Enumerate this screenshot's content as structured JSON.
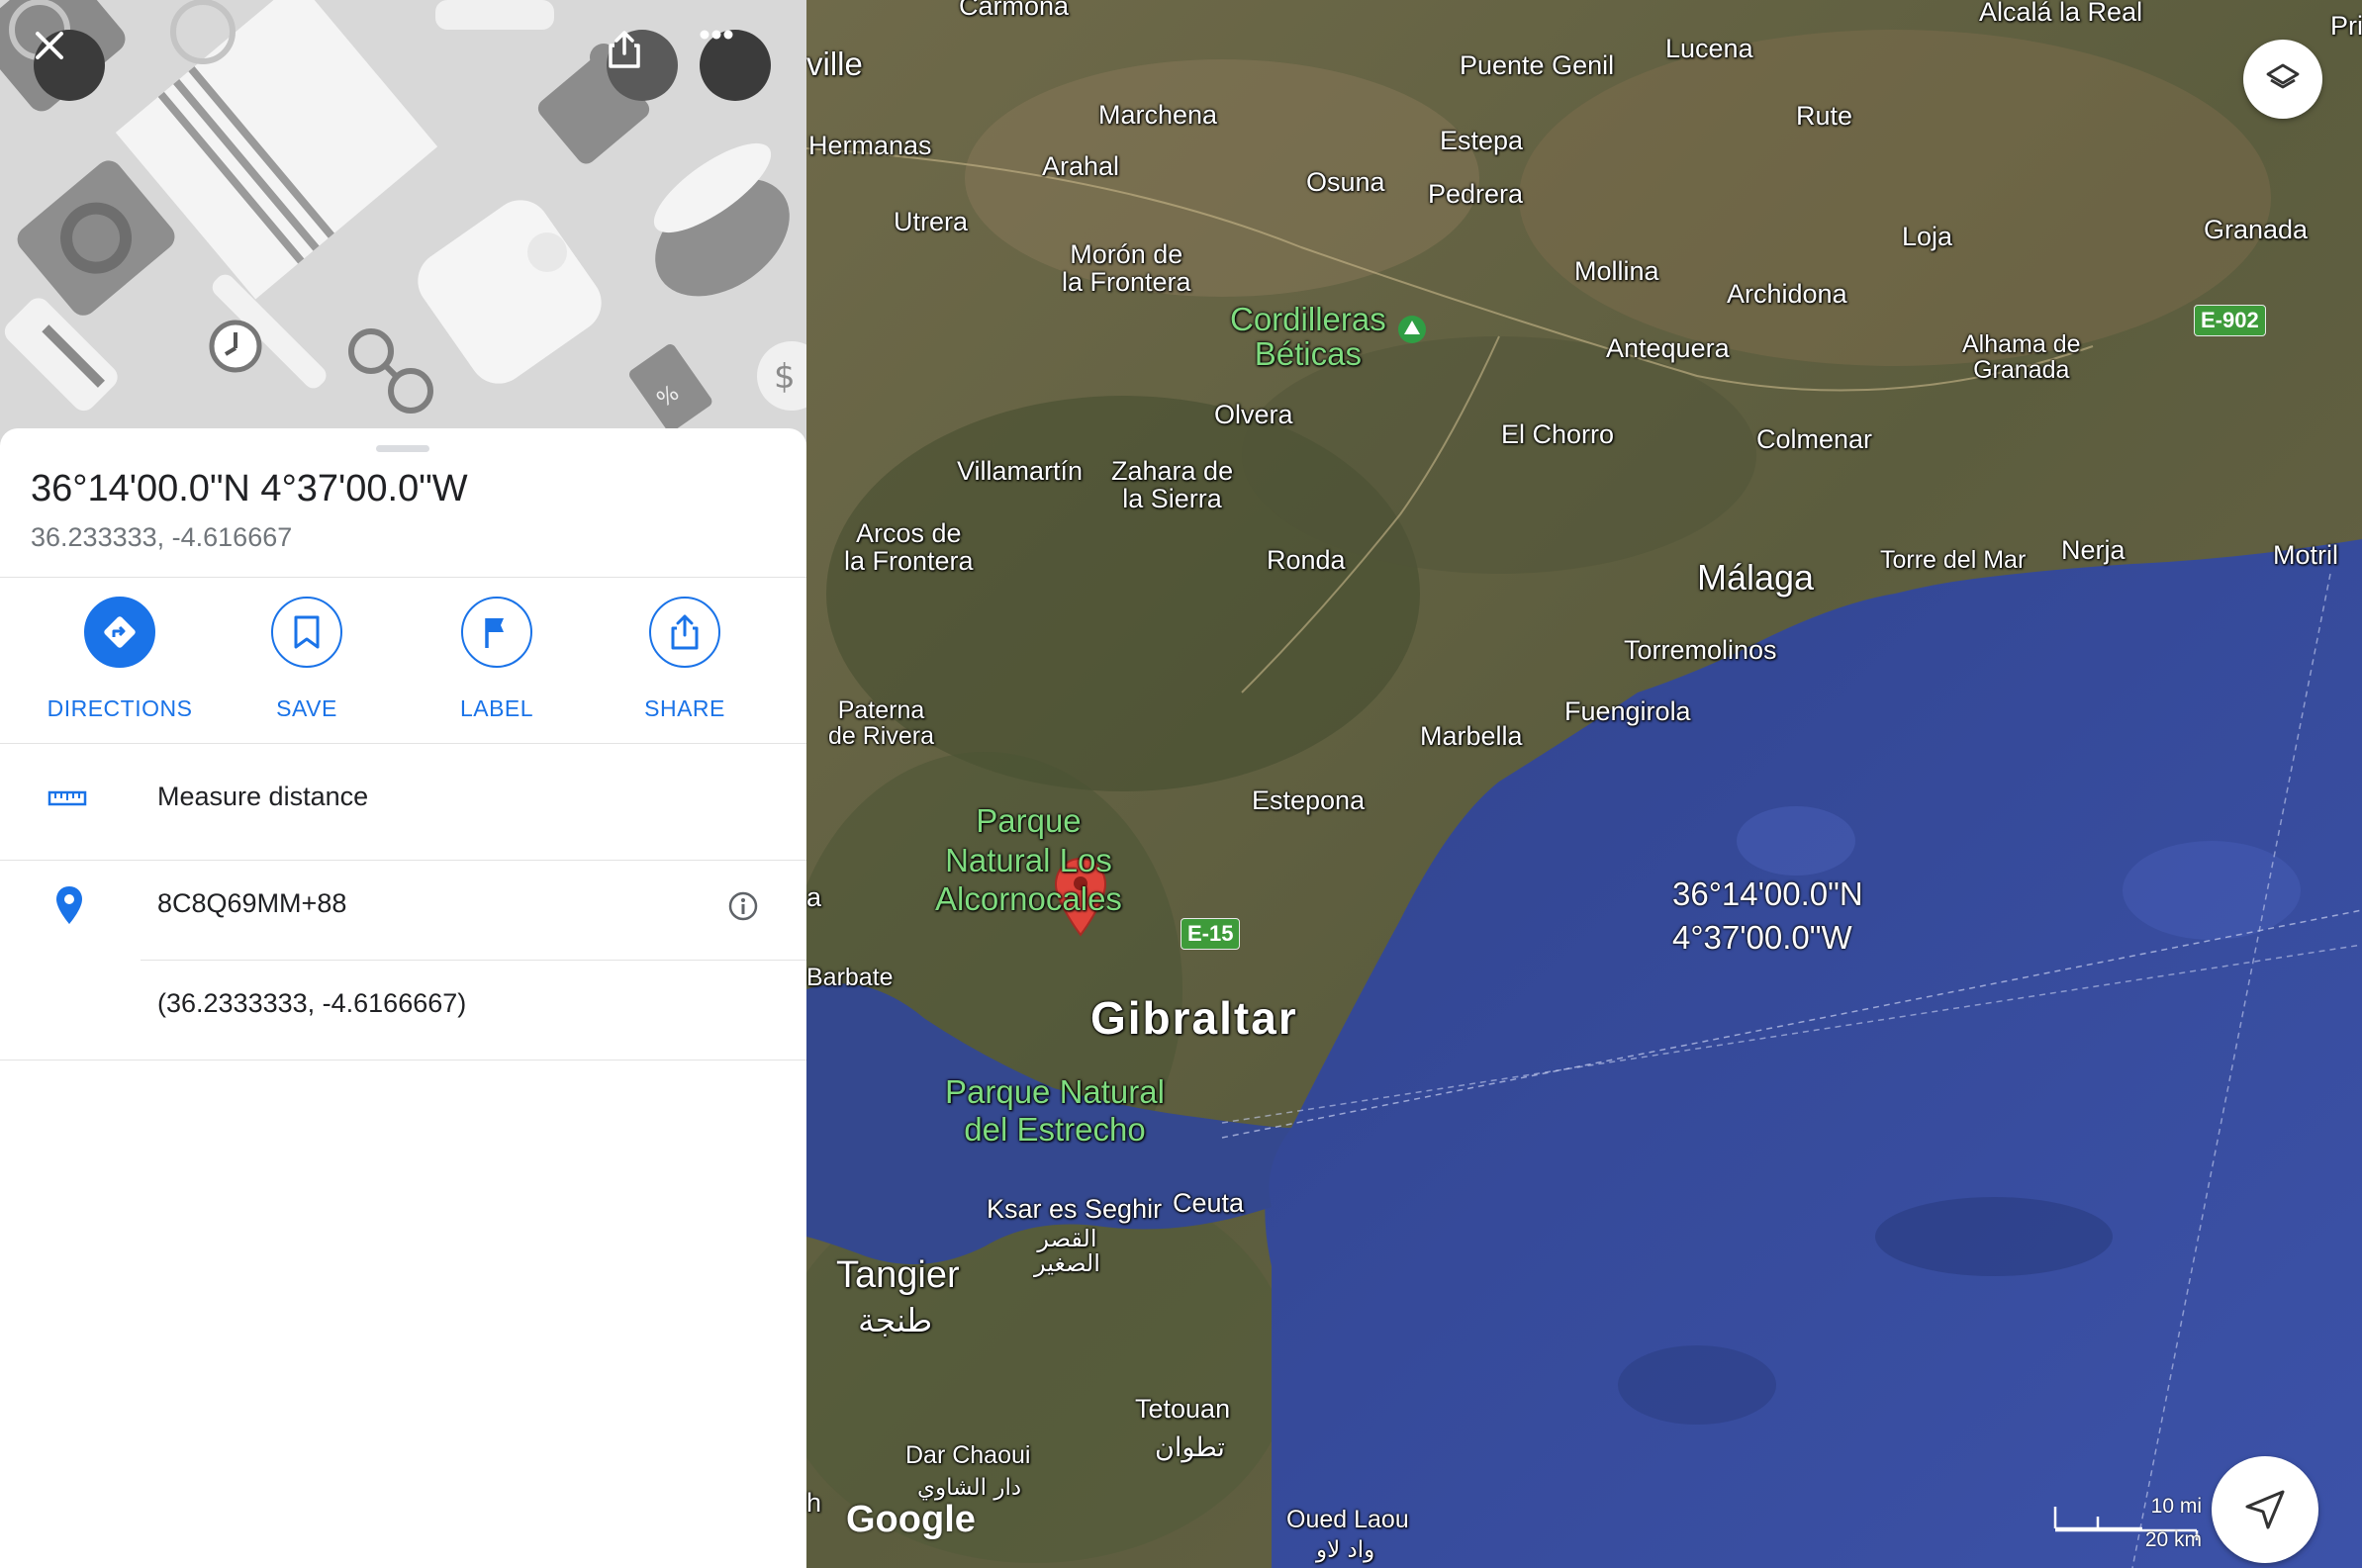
{
  "place": {
    "dms": "36°14'00.0\"N 4°37'00.0\"W",
    "decimal": "36.233333, -4.616667"
  },
  "actions": [
    {
      "label": "DIRECTIONS",
      "icon": "directions-icon"
    },
    {
      "label": "SAVE",
      "icon": "bookmark-icon"
    },
    {
      "label": "LABEL",
      "icon": "flag-icon"
    },
    {
      "label": "SHARE",
      "icon": "share-icon"
    }
  ],
  "rows": {
    "measure": "Measure distance",
    "plus_code": "8C8Q69MM+88",
    "coords": "(36.2333333, -4.6166667)"
  },
  "map": {
    "pin_label_line1": "36°14'00.0\"N",
    "pin_label_line2": "4°37'00.0\"W",
    "scale_mi": "10 mi",
    "scale_km": "20 km",
    "google": "Google",
    "roads": {
      "e15": "E-15",
      "e902": "E-902"
    },
    "labels": {
      "carmona": "Carmona",
      "ville": "ville",
      "alcala": "Alcalá la Real",
      "pri": "Pri",
      "puente_genil": "Puente Genil",
      "lucena": "Lucena",
      "marchena": "Marchena",
      "rute": "Rute",
      "hermanas": "Hermanas",
      "arahal": "Arahal",
      "estepa": "Estepa",
      "osuna": "Osuna",
      "pedrera": "Pedrera",
      "utrera": "Utrera",
      "loja": "Loja",
      "granada": "Granada",
      "moron": "Morón de\nla Frontera",
      "mollina": "Mollina",
      "archidona": "Archidona",
      "cordilleras": "Cordilleras\nBéticas",
      "antequera": "Antequera",
      "alhama": "Alhama de\nGranada",
      "olvera": "Olvera",
      "el_chorro": "El Chorro",
      "colmenar": "Colmenar",
      "villamartin": "Villamartín",
      "zahara": "Zahara de\nla Sierra",
      "arcos": "Arcos de\nla Frontera",
      "ronda": "Ronda",
      "malaga": "Málaga",
      "torre_del_mar": "Torre del Mar",
      "nerja": "Nerja",
      "motril": "Motril",
      "torremolinos": "Torremolinos",
      "paterna": "Paterna\nde Rivera",
      "fuengirola": "Fuengirola",
      "marbella": "Marbella",
      "estepona": "Estepona",
      "parque_alcornocales": "Parque\nNatural Los\nAlcornocales",
      "a": "a",
      "barbate": "Barbate",
      "gibraltar": "Gibraltar",
      "parque_estrecho": "Parque Natural\ndel Estrecho",
      "ksar": "Ksar es Seghir",
      "ksar_ar": "القصر\nالصغير",
      "ceuta": "Ceuta",
      "tangier": "Tangier",
      "tangier_ar": "طنجة",
      "tetouan": "Tetouan",
      "tetouan_ar": "تطوان",
      "dar_chaoui": "Dar Chaoui",
      "dar_chaoui_ar": "دار الشاوي",
      "oued_laou": "Oued Laou",
      "oued_laou_ar": "واد لاو",
      "h": "h"
    }
  }
}
